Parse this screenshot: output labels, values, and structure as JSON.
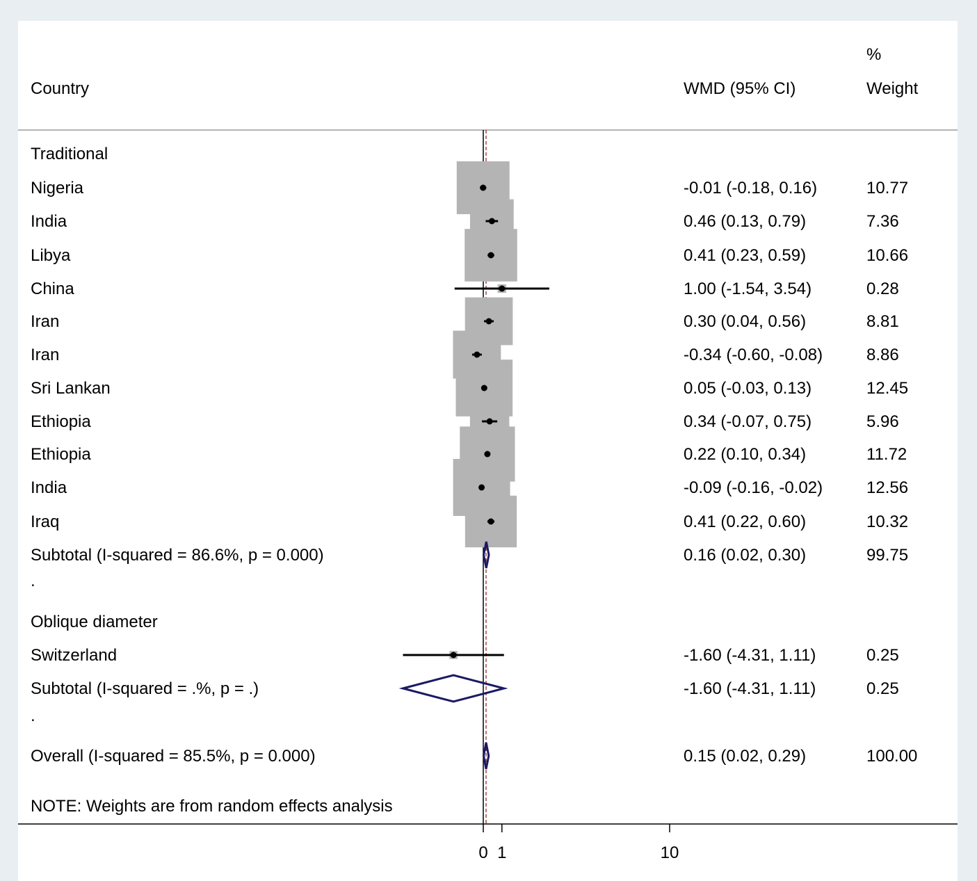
{
  "chart_data": {
    "type": "forest",
    "columns": {
      "study": "Country",
      "effect": "WMD (95% CI)",
      "weight_line1": "%",
      "weight_line2": "Weight"
    },
    "x_axis": {
      "ticks": [
        0,
        1,
        10
      ],
      "tick_labels": [
        "0",
        "1",
        "10"
      ],
      "null_line": 0,
      "overall_line": 0.15
    },
    "groups": [
      {
        "name": "Traditional",
        "studies": [
          {
            "label": "Nigeria",
            "wmd": -0.01,
            "lower": -0.18,
            "upper": 0.16,
            "ci_text": "-0.01 (-0.18, 0.16)",
            "weight": 10.77,
            "weight_text": "10.77"
          },
          {
            "label": "India",
            "wmd": 0.46,
            "lower": 0.13,
            "upper": 0.79,
            "ci_text": "0.46 (0.13, 0.79)",
            "weight": 7.36,
            "weight_text": "7.36"
          },
          {
            "label": "Libya",
            "wmd": 0.41,
            "lower": 0.23,
            "upper": 0.59,
            "ci_text": "0.41 (0.23, 0.59)",
            "weight": 10.66,
            "weight_text": "10.66"
          },
          {
            "label": "China",
            "wmd": 1.0,
            "lower": -1.54,
            "upper": 3.54,
            "ci_text": "1.00 (-1.54, 3.54)",
            "weight": 0.28,
            "weight_text": "0.28"
          },
          {
            "label": "Iran",
            "wmd": 0.3,
            "lower": 0.04,
            "upper": 0.56,
            "ci_text": "0.30 (0.04, 0.56)",
            "weight": 8.81,
            "weight_text": "8.81"
          },
          {
            "label": "Iran",
            "wmd": -0.34,
            "lower": -0.6,
            "upper": -0.08,
            "ci_text": "-0.34 (-0.60, -0.08)",
            "weight": 8.86,
            "weight_text": "8.86"
          },
          {
            "label": "Sri Lankan",
            "wmd": 0.05,
            "lower": -0.03,
            "upper": 0.13,
            "ci_text": "0.05 (-0.03, 0.13)",
            "weight": 12.45,
            "weight_text": "12.45"
          },
          {
            "label": "Ethiopia",
            "wmd": 0.34,
            "lower": -0.07,
            "upper": 0.75,
            "ci_text": "0.34 (-0.07, 0.75)",
            "weight": 5.96,
            "weight_text": "5.96"
          },
          {
            "label": "Ethiopia",
            "wmd": 0.22,
            "lower": 0.1,
            "upper": 0.34,
            "ci_text": "0.22 (0.10, 0.34)",
            "weight": 11.72,
            "weight_text": "11.72"
          },
          {
            "label": "India",
            "wmd": -0.09,
            "lower": -0.16,
            "upper": -0.02,
            "ci_text": "-0.09 (-0.16, -0.02)",
            "weight": 12.56,
            "weight_text": "12.56"
          },
          {
            "label": "Iraq",
            "wmd": 0.41,
            "lower": 0.22,
            "upper": 0.6,
            "ci_text": "0.41 (0.22, 0.60)",
            "weight": 10.32,
            "weight_text": "10.32"
          }
        ],
        "subtotal": {
          "label": "Subtotal  (I-squared = 86.6%, p = 0.000)",
          "wmd": 0.16,
          "lower": 0.02,
          "upper": 0.3,
          "ci_text": "0.16 (0.02, 0.30)",
          "weight_text": "99.75"
        },
        "separator": "."
      },
      {
        "name": "Oblique diameter",
        "studies": [
          {
            "label": "Switzerland",
            "wmd": -1.6,
            "lower": -4.31,
            "upper": 1.11,
            "ci_text": "-1.60 (-4.31, 1.11)",
            "weight": 0.25,
            "weight_text": "0.25"
          }
        ],
        "subtotal": {
          "label": "Subtotal  (I-squared = .%, p = .)",
          "wmd": -1.6,
          "lower": -4.31,
          "upper": 1.11,
          "ci_text": "-1.60 (-4.31, 1.11)",
          "weight_text": "0.25"
        },
        "separator": "."
      }
    ],
    "overall": {
      "label": "Overall  (I-squared = 85.5%, p = 0.000)",
      "wmd": 0.15,
      "lower": 0.02,
      "upper": 0.29,
      "ci_text": "0.15 (0.02, 0.29)",
      "weight_text": "100.00"
    },
    "note": "NOTE: Weights are from random effects analysis",
    "colors": {
      "box": "#b4b4b4",
      "diamond": "#1a1a66",
      "overall_line": "#8b1a1a",
      "text": "#000000",
      "background": "#e9eef2",
      "panel": "#ffffff"
    }
  }
}
